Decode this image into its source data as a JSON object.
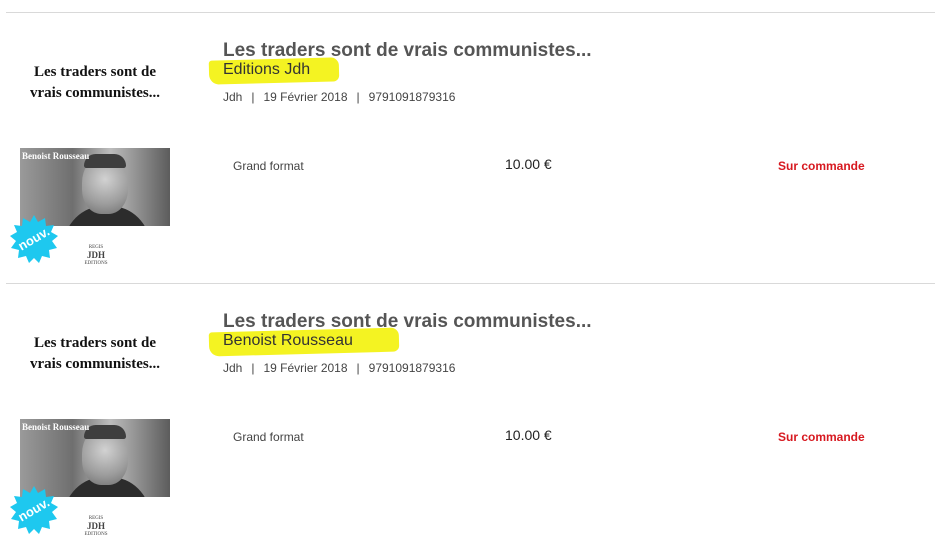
{
  "products": [
    {
      "cover": {
        "title_line1": "Les traders sont de",
        "title_line2": "vrais communistes...",
        "author_strip": "Benoist Rousseau",
        "publisher_line1": "REGIS",
        "publisher_mark": "JDH",
        "publisher_line2": "EDITIONS",
        "badge": "nouv.",
        "badge_color": "#1ec8ef"
      },
      "title": "Les traders sont de vrais communistes...",
      "highlight": "Editions Jdh",
      "meta": {
        "publisher": "Jdh",
        "date": "19 Février 2018",
        "isbn": "9791091879316"
      },
      "format": "Grand format",
      "price": "10.00 €",
      "availability": "Sur commande"
    },
    {
      "cover": {
        "title_line1": "Les traders sont de",
        "title_line2": "vrais communistes...",
        "author_strip": "Benoist Rousseau",
        "publisher_line1": "REGIS",
        "publisher_mark": "JDH",
        "publisher_line2": "EDITIONS",
        "badge": "nouv.",
        "badge_color": "#1ec8ef"
      },
      "title": "Les traders sont de vrais communistes...",
      "highlight": "Benoist Rousseau",
      "meta": {
        "publisher": "Jdh",
        "date": "19 Février 2018",
        "isbn": "9791091879316"
      },
      "format": "Grand format",
      "price": "10.00 €",
      "availability": "Sur commande"
    }
  ],
  "colors": {
    "highlight": "#f4f322",
    "availability": "#d71920",
    "badge": "#1ec8ef"
  }
}
